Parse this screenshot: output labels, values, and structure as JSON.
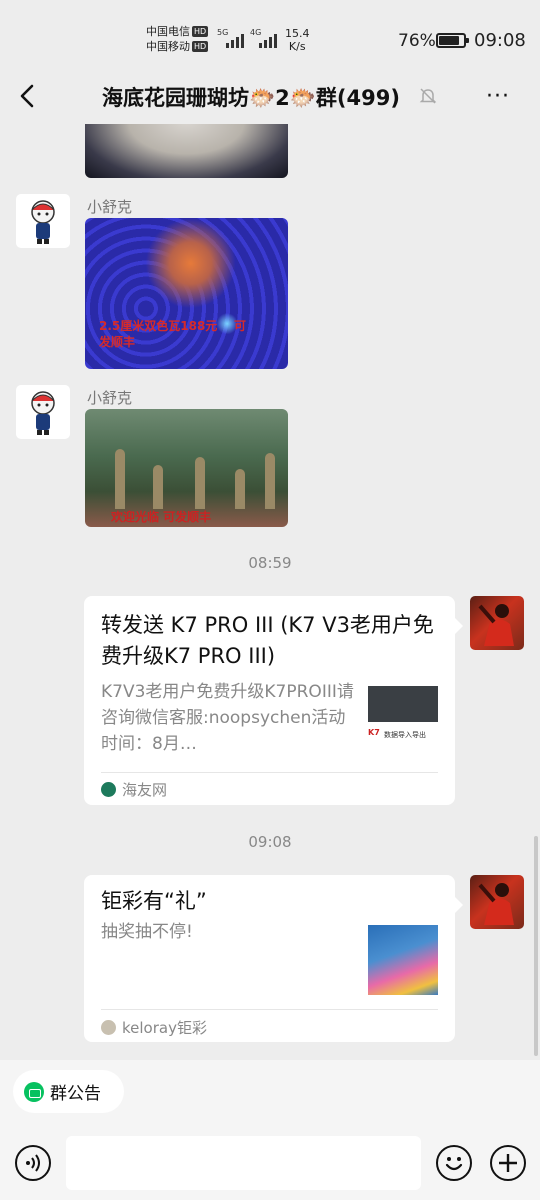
{
  "status_bar": {
    "carrier1": "中国电信",
    "carrier2": "中国移动",
    "hd": "HD",
    "net1": "5G",
    "net2": "4G",
    "speed_value": "15.4",
    "speed_unit": "K/s",
    "battery": "76%",
    "time": "09:08"
  },
  "header": {
    "title": "海底花园珊瑚坊🐡2🐡群(499)",
    "more": "···",
    "back_icon": "chevron-left-icon",
    "mute_icon": "bell-off-icon"
  },
  "messages": {
    "sender1": "小舒克",
    "img2_caption": "2.5厘米双色瓦188元    可\n发顺丰",
    "sender2": "小舒克",
    "img3_caption": "欢迎光临    可发顺丰",
    "time1": "08:59",
    "card1": {
      "title": "转发送 K7 PRO III (K7 V3老用户免费升级K7 PRO III)",
      "desc": "K7V3老用户免费升级K7PROIII请咨询微信客服:noopsychen活动时间：8月…",
      "thumb_text": "数据导入导出",
      "source": "海友网"
    },
    "time2": "09:08",
    "card2": {
      "title": "钜彩有“礼”",
      "desc": "抽奖抽不停!",
      "source": "keloray钜彩"
    }
  },
  "bottom": {
    "notice": "群公告",
    "input_value": ""
  }
}
